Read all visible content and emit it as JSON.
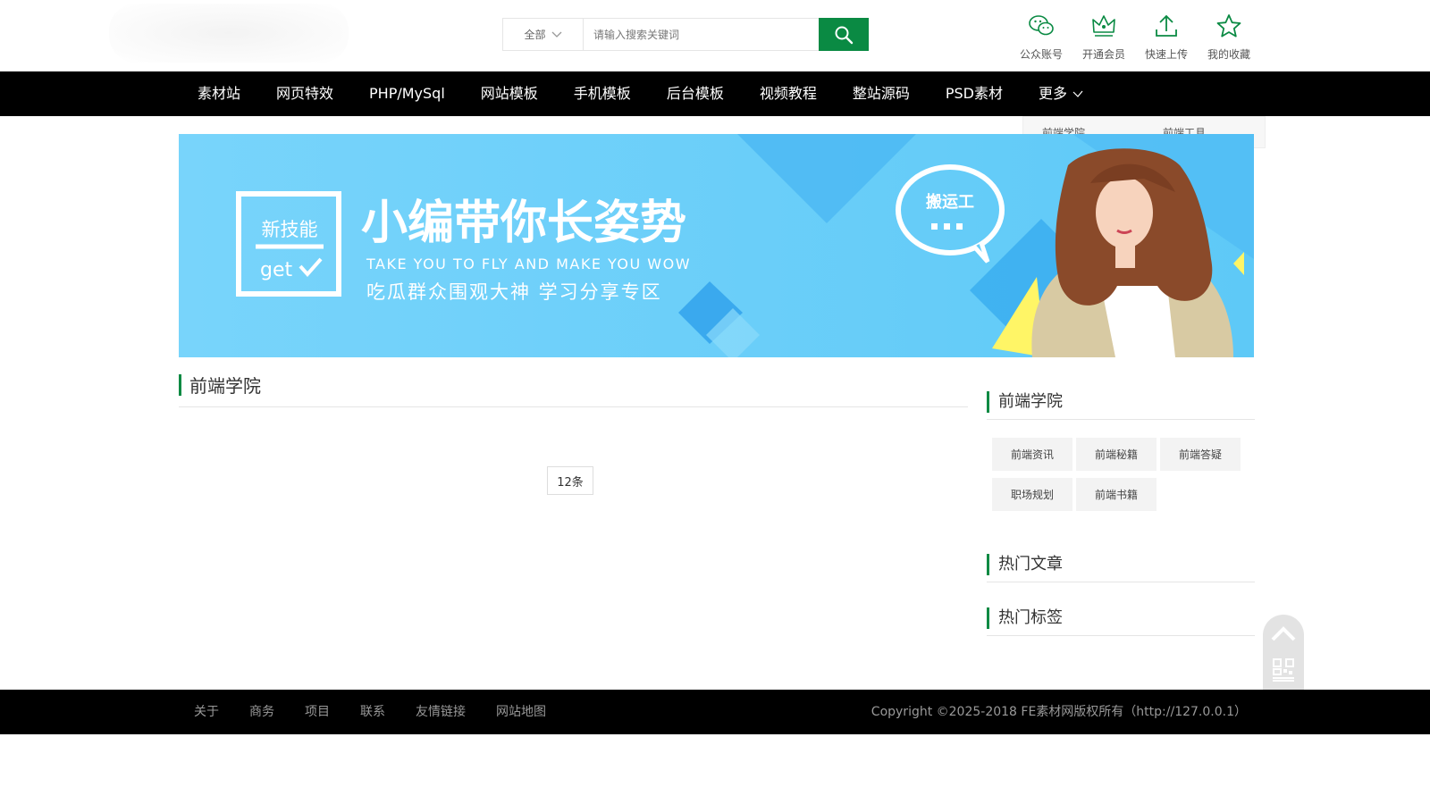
{
  "header": {
    "search": {
      "category": "全部",
      "placeholder": "请输入搜索关键词"
    },
    "icons": [
      {
        "label": "公众账号",
        "icon": "wechat-icon"
      },
      {
        "label": "开通会员",
        "icon": "crown-icon"
      },
      {
        "label": "快速上传",
        "icon": "upload-icon"
      },
      {
        "label": "我的收藏",
        "icon": "star-icon"
      }
    ]
  },
  "nav": {
    "items": [
      "素材站",
      "网页特效",
      "PHP/MySql",
      "网站模板",
      "手机模板",
      "后台模板",
      "视频教程",
      "整站源码",
      "PSD素材",
      "更多"
    ],
    "dropdown": [
      "前端学院",
      "前端工具"
    ]
  },
  "banner": {
    "badge_line1": "新技能",
    "badge_line2": "get",
    "headline": "小编带你长姿势",
    "sub_en": "TAKE YOU TO FLY AND MAKE YOU WOW",
    "sub_cn": "吃瓜群众围观大神 学习分享专区",
    "bubble": "搬运工"
  },
  "main": {
    "title": "前端学院",
    "pager": "12条"
  },
  "sidebar": {
    "category_title": "前端学院",
    "tags": [
      "前端资讯",
      "前端秘籍",
      "前端答疑",
      "职场规划",
      "前端书籍"
    ],
    "hot_articles_title": "热门文章",
    "hot_tags_title": "热门标签"
  },
  "footer": {
    "links": [
      "关于",
      "商务",
      "项目",
      "联系",
      "友情链接",
      "网站地图"
    ],
    "copyright": "Copyright ©2025-2018 FE素材网版权所有（http://127.0.0.1）"
  },
  "colors": {
    "accent": "#0a8a43",
    "nav_bg": "#000000",
    "banner_bg": "#68cdf8"
  }
}
